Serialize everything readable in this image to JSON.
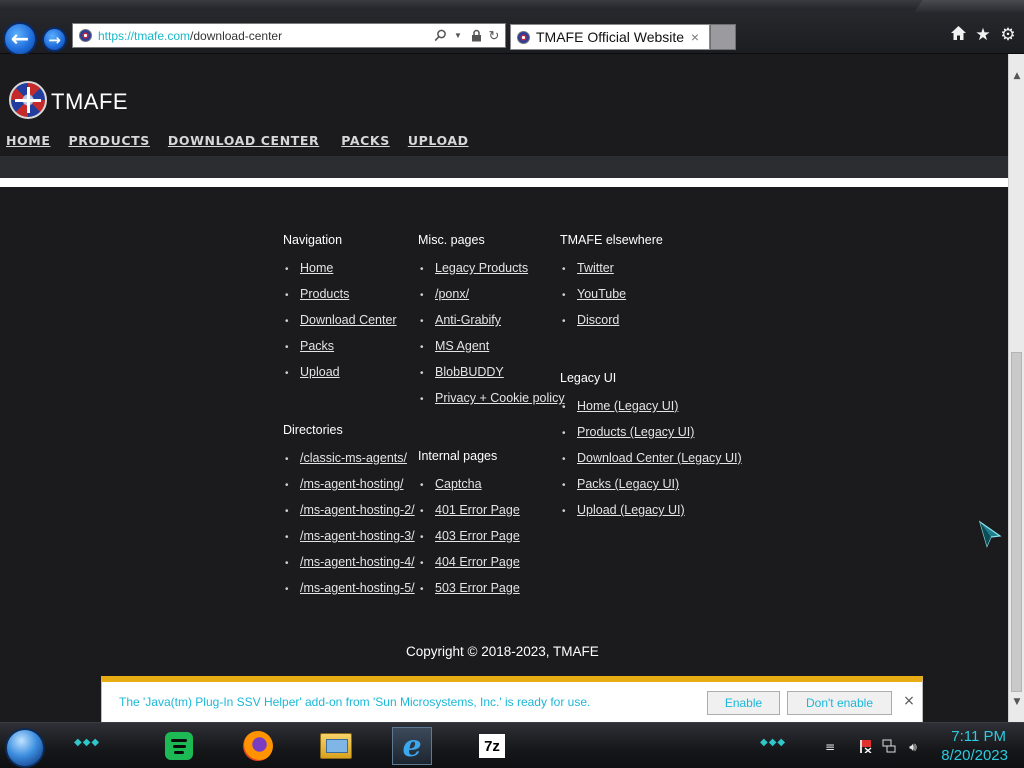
{
  "browser": {
    "url_scheme": "https://",
    "url_host": "tmafe.com",
    "url_path": "/download-center",
    "tab_title": "TMAFE Official Website",
    "tab_close": "×"
  },
  "site": {
    "name": "TMAFE",
    "nav": [
      "HOME",
      "PRODUCTS",
      "DOWNLOAD CENTER",
      "PACKS",
      "UPLOAD"
    ]
  },
  "footer": {
    "navigation": {
      "title": "Navigation",
      "items": [
        "Home",
        "Products",
        "Download Center",
        "Packs",
        "Upload"
      ]
    },
    "directories": {
      "title": "Directories",
      "items": [
        "/classic-ms-agents/",
        "/ms-agent-hosting/",
        "/ms-agent-hosting-2/",
        "/ms-agent-hosting-3/",
        "/ms-agent-hosting-4/",
        "/ms-agent-hosting-5/"
      ]
    },
    "misc": {
      "title": "Misc. pages",
      "items": [
        "Legacy Products",
        "/ponx/",
        "Anti-Grabify",
        "MS Agent",
        "BlobBUDDY",
        "Privacy + Cookie policy"
      ]
    },
    "internal": {
      "title": "Internal pages",
      "items": [
        "Captcha",
        "401 Error Page",
        "403 Error Page",
        "404 Error Page",
        "503 Error Page"
      ]
    },
    "elsewhere": {
      "title": "TMAFE elsewhere",
      "items": [
        "Twitter",
        "YouTube",
        "Discord"
      ]
    },
    "legacy": {
      "title": "Legacy UI",
      "items": [
        "Home (Legacy UI)",
        "Products (Legacy UI)",
        "Download Center (Legacy UI)",
        "Packs (Legacy UI)",
        "Upload (Legacy UI)"
      ]
    },
    "copyright": "Copyright © 2018-2023, TMAFE"
  },
  "notification": {
    "message": "The 'Java(tm) Plug-In SSV Helper' add-on from 'Sun Microsystems, Inc.' is ready for use.",
    "enable_label": "Enable",
    "dont_enable_label": "Don't enable",
    "close_label": "×"
  },
  "taskbar": {
    "apps": [
      "spotify-icon",
      "firefox-icon",
      "file-explorer-icon",
      "internet-explorer-icon",
      "7zip-icon"
    ],
    "ie_glyph": "e",
    "sevenzip_label": "7z",
    "time": "7:11 PM",
    "date": "8/20/2023"
  },
  "colors": {
    "page_background": "#1b1b1e",
    "accent_cyan": "#2ccbe0",
    "notification_border": "#e7ad12"
  }
}
